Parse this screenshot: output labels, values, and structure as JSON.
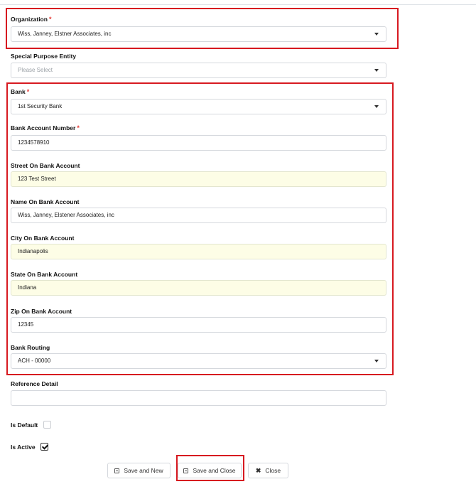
{
  "form": {
    "organization": {
      "label": "Organization",
      "required_mark": "*",
      "value": "Wiss, Janney, Elstner Associates, inc"
    },
    "special_purpose_entity": {
      "label": "Special Purpose Entity",
      "placeholder": "Please Select"
    },
    "bank": {
      "label": "Bank",
      "required_mark": "*",
      "value": "1st Security Bank"
    },
    "bank_account_number": {
      "label": "Bank Account Number",
      "required_mark": "*",
      "value": "1234578910"
    },
    "street": {
      "label": "Street On Bank Account",
      "value": "123 Test Street"
    },
    "name": {
      "label": "Name On Bank Account",
      "value": "Wiss, Janney, Elstener Associates, inc"
    },
    "city": {
      "label": "City On Bank Account",
      "value": "Indianapolis"
    },
    "state": {
      "label": "State On Bank Account",
      "value": "Indiana"
    },
    "zip": {
      "label": "Zip On Bank Account",
      "value": "12345"
    },
    "routing": {
      "label": "Bank Routing",
      "value": "ACH - 00000"
    },
    "reference": {
      "label": "Reference Detail",
      "value": ""
    },
    "is_default": {
      "label": "Is Default",
      "checked": false
    },
    "is_active": {
      "label": "Is Active",
      "checked": true
    }
  },
  "buttons": {
    "save_new": "Save and New",
    "save_close": "Save and Close",
    "close": "Close"
  },
  "colors": {
    "highlight": "#d71920",
    "required": "#e53935",
    "autofill": "#fdfde6"
  }
}
